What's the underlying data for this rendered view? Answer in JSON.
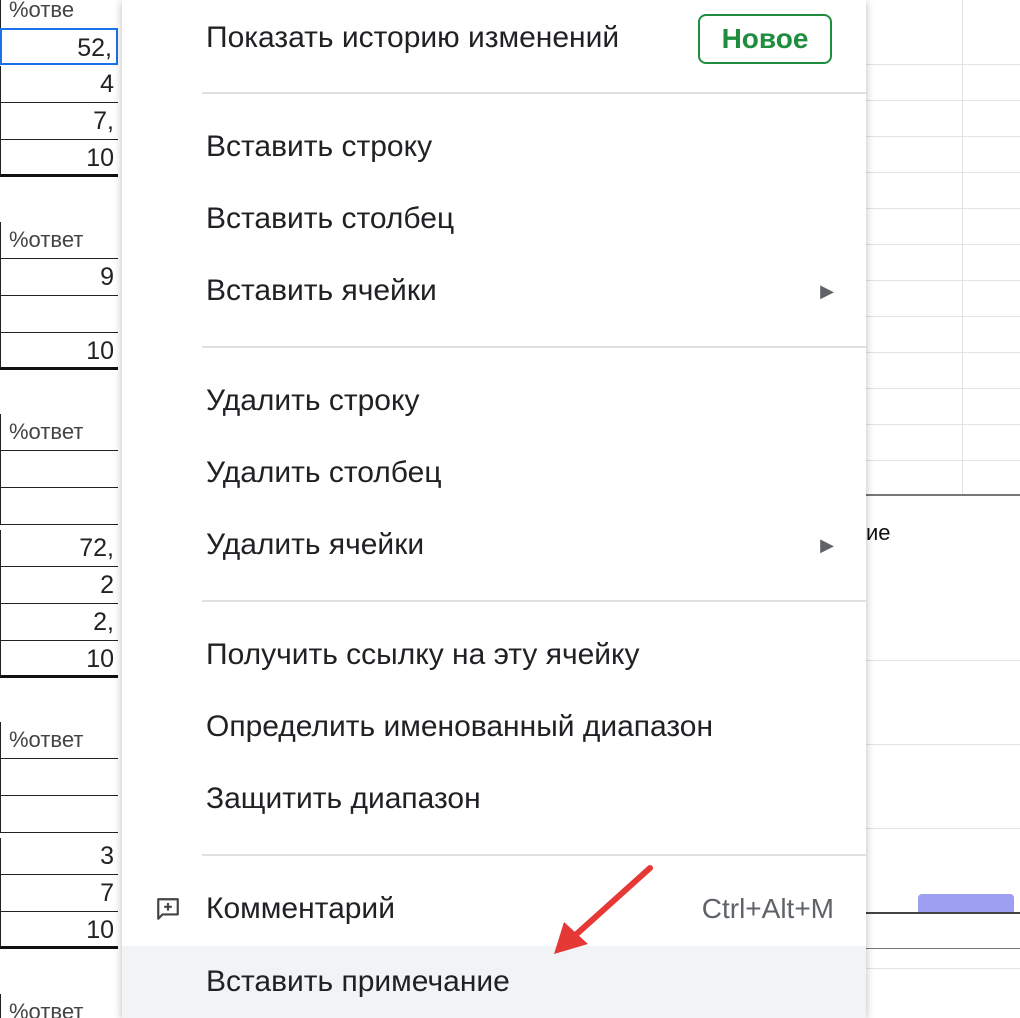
{
  "menu": {
    "history": {
      "label": "Показать историю изменений",
      "badge": "Новое"
    },
    "insert_row": "Вставить строку",
    "insert_column": "Вставить столбец",
    "insert_cells": "Вставить ячейки",
    "delete_row": "Удалить строку",
    "delete_column": "Удалить столбец",
    "delete_cells": "Удалить ячейки",
    "get_link": "Получить ссылку на эту ячейку",
    "define_named_range": "Определить именованный диапазон",
    "protect_range": "Защитить диапазон",
    "comment": {
      "label": "Комментарий",
      "shortcut": "Ctrl+Alt+M"
    },
    "insert_note": "Вставить примечание"
  },
  "sheet": {
    "left_cells": [
      "%отве",
      "52,",
      "4",
      "7,",
      "10",
      "%ответ",
      "9",
      "",
      "10",
      "%ответ",
      "",
      "",
      "72,",
      "2",
      "2,",
      "10",
      "%ответ",
      "",
      "",
      "3",
      "7",
      "10",
      "%ответ"
    ],
    "right_fragment": "ие"
  },
  "colors": {
    "badge": "#1e8e3e",
    "hover": "#f1f3f4",
    "arrow_annotation": "#e53935",
    "chart_bar": "#9e9ef2",
    "selection": "#1a73e8"
  }
}
